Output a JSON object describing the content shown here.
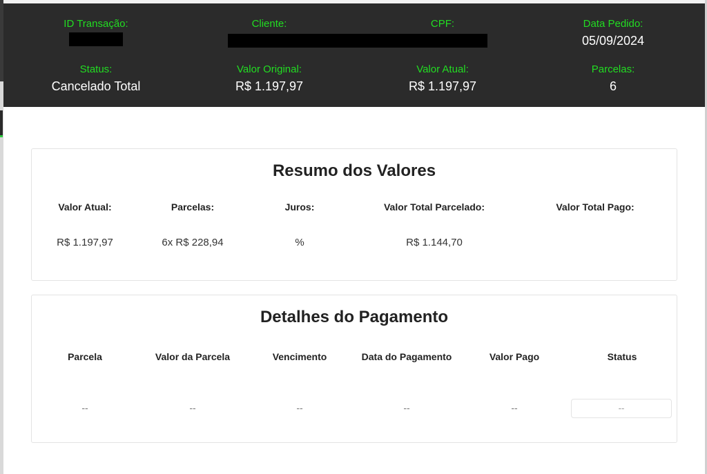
{
  "header": {
    "id_transacao": {
      "label": "ID Transação:"
    },
    "cliente": {
      "label": "Cliente:"
    },
    "cpf": {
      "label": "CPF:"
    },
    "data_pedido": {
      "label": "Data Pedido:",
      "value": "05/09/2024"
    },
    "status": {
      "label": "Status:",
      "value": "Cancelado Total"
    },
    "valor_original": {
      "label": "Valor Original:",
      "value": "R$ 1.197,97"
    },
    "valor_atual": {
      "label": "Valor Atual:",
      "value": "R$ 1.197,97"
    },
    "parcelas": {
      "label": "Parcelas:",
      "value": "6"
    }
  },
  "resumo": {
    "title": "Resumo dos Valores",
    "columns": [
      {
        "label": "Valor Atual:",
        "value": "R$ 1.197,97"
      },
      {
        "label": "Parcelas:",
        "value": "6x R$ 228,94"
      },
      {
        "label": "Juros:",
        "value": "%"
      },
      {
        "label": "Valor Total Parcelado:",
        "value": "R$ 1.144,70"
      },
      {
        "label": "Valor Total Pago:",
        "value": ""
      }
    ]
  },
  "detalhes": {
    "title": "Detalhes do Pagamento",
    "columns": [
      "Parcela",
      "Valor da Parcela",
      "Vencimento",
      "Data do Pagamento",
      "Valor Pago",
      "Status"
    ],
    "row": [
      "--",
      "--",
      "--",
      "--",
      "--",
      "--"
    ]
  },
  "colors": {
    "header_bg": "#2b2b2b",
    "label_green": "#22dd22",
    "redaction": "#000000"
  }
}
